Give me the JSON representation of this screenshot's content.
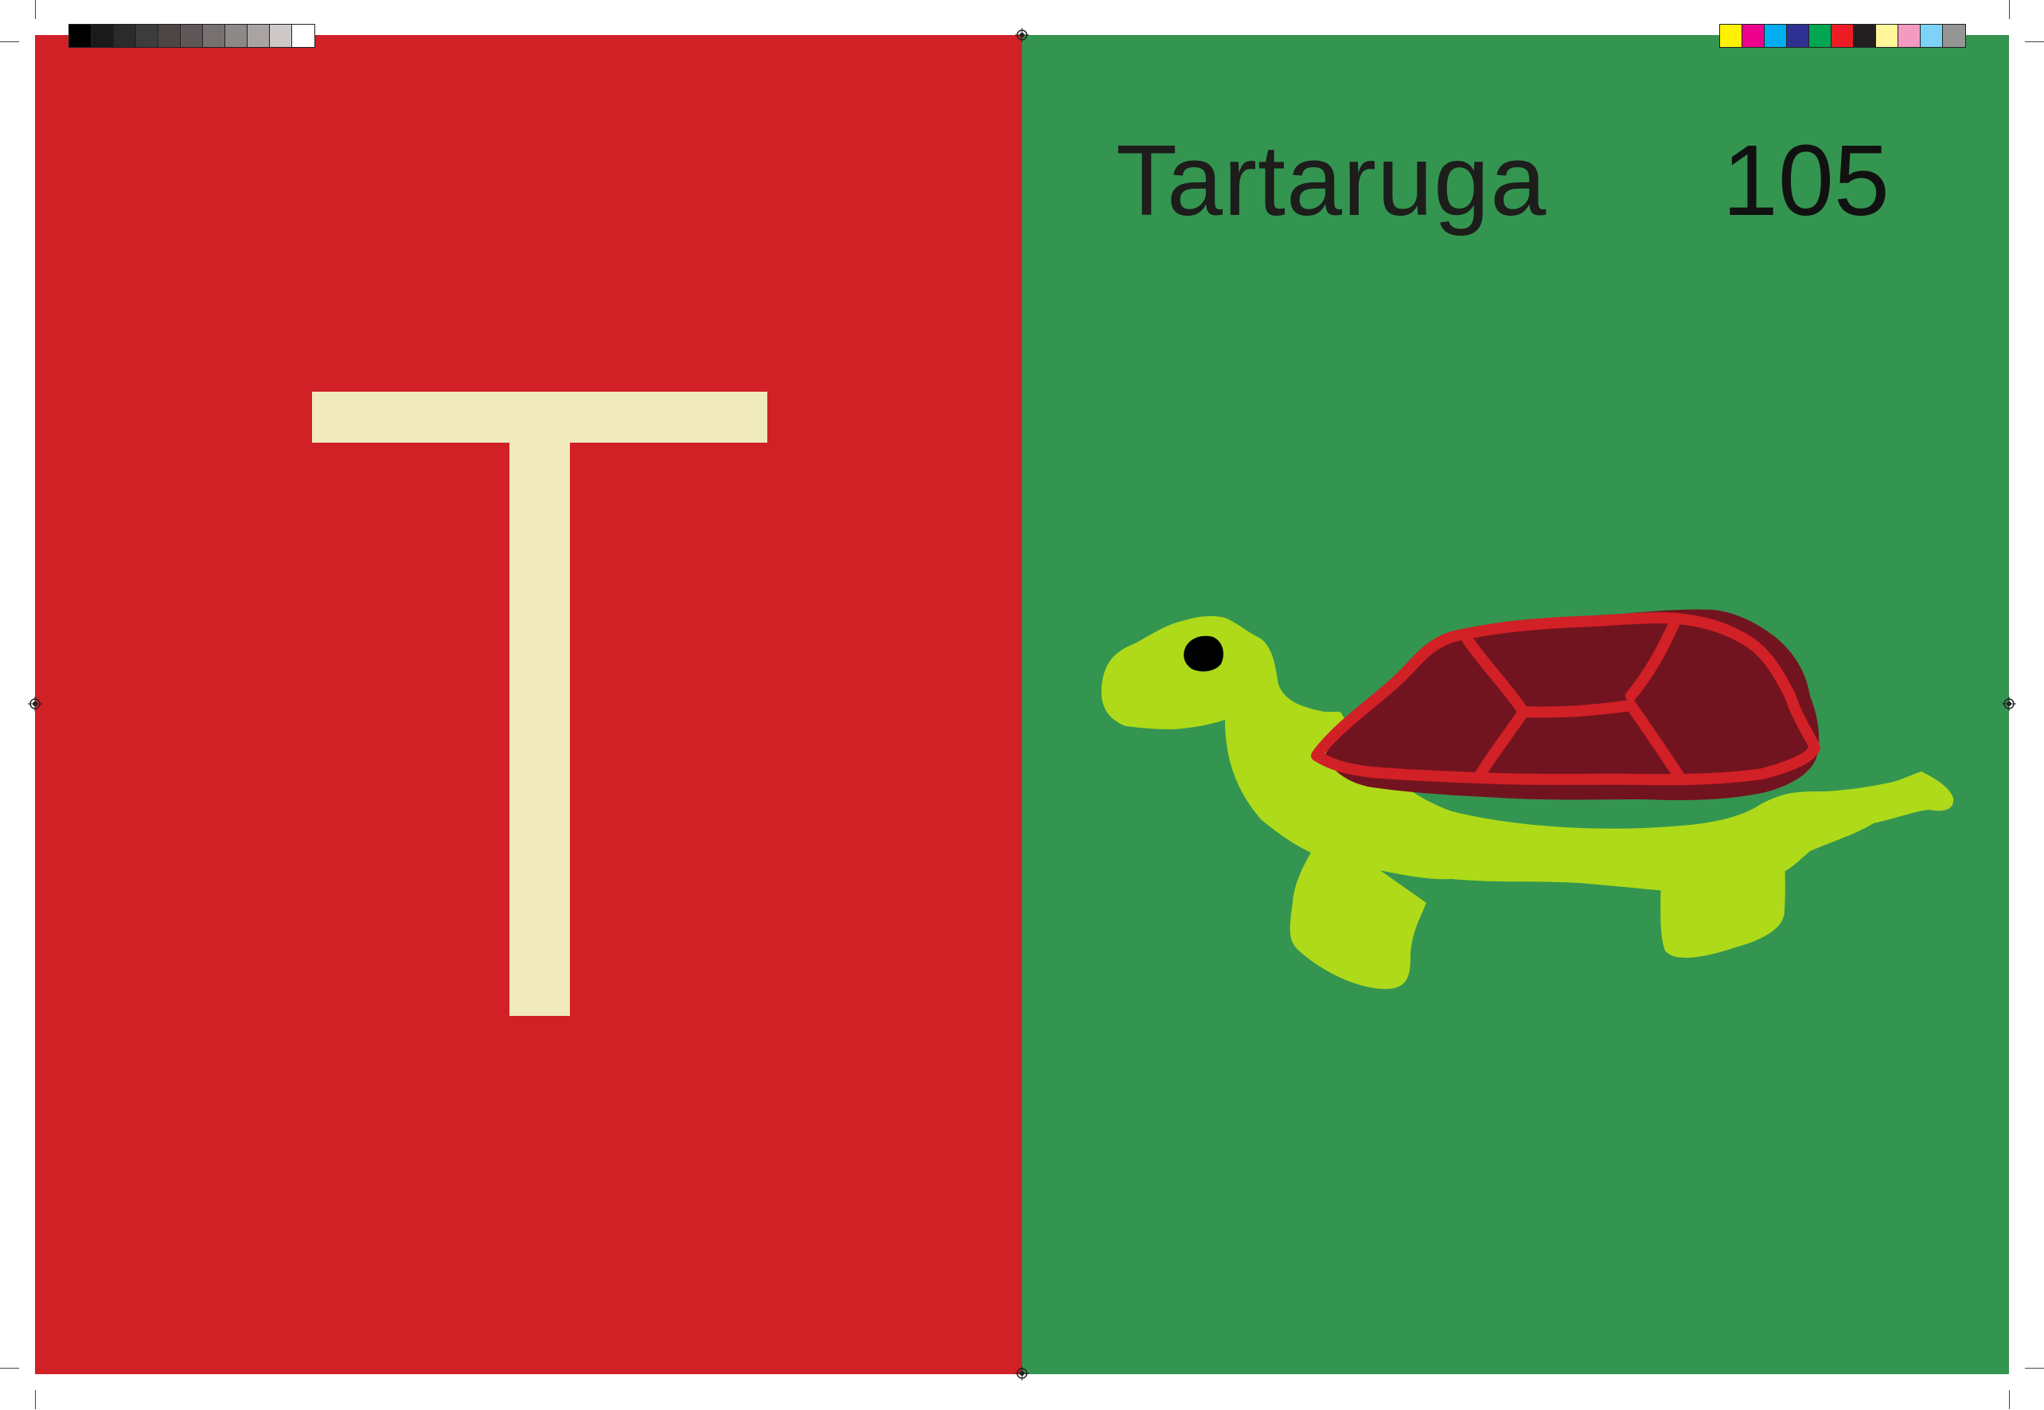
{
  "left_page": {
    "background": "#d12026",
    "letter": "T",
    "letter_color": "#f0eabd"
  },
  "right_page": {
    "background": "#349550",
    "word": "Tartaruga",
    "page_number": "105",
    "illustration": "turtle",
    "colors": {
      "body": "#aeda1a",
      "shell": "#72141f",
      "shell_outline": "#d12026",
      "eye": "#000000"
    }
  },
  "print_marks": {
    "gray_bar": [
      "#000000",
      "#1a1a1a",
      "#2b2b2b",
      "#3c3c3c",
      "#4e4646",
      "#5f5757",
      "#777070",
      "#8f8888",
      "#aaa3a3",
      "#cdc7c7",
      "#ffffff"
    ],
    "color_bar": [
      "#fff200",
      "#ec008c",
      "#00aeef",
      "#2e3192",
      "#00a651",
      "#ed1c24",
      "#231f20",
      "#fff799",
      "#f49ac1",
      "#7dd3f7",
      "#959595"
    ]
  }
}
